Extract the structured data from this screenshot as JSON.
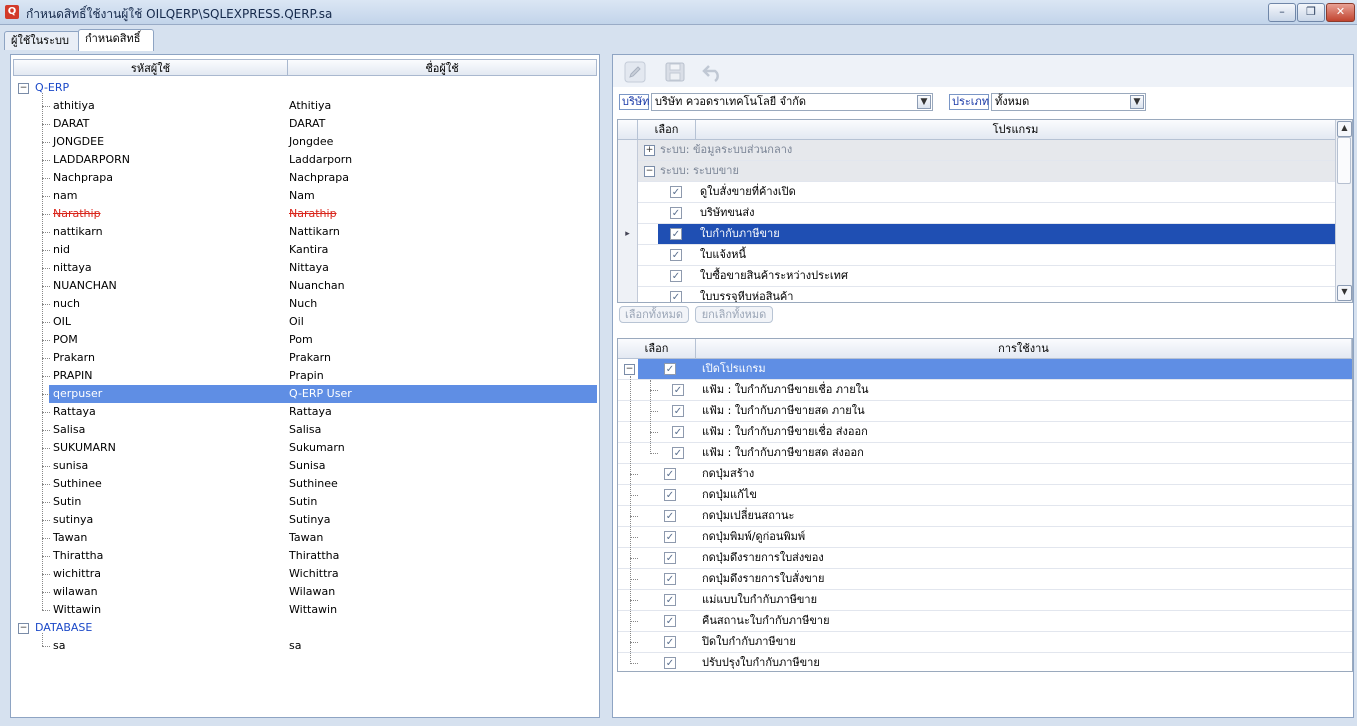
{
  "window": {
    "title": "กำหนดสิทธิ์ใช้งานผู้ใช้   OILQERP\\SQLEXPRESS.QERP.sa",
    "minimize": "–",
    "restore": "❐",
    "close": "✕"
  },
  "tabs": [
    "ผู้ใช้ในระบบ",
    "กำหนดสิทธิ์"
  ],
  "users_panel": {
    "col_code": "รหัสผู้ใช้",
    "col_name": "ชื่อผู้ใช้",
    "group1": "Q-ERP",
    "group2": "DATABASE",
    "users": [
      {
        "code": "athitiya",
        "name": "Athitiya"
      },
      {
        "code": "DARAT",
        "name": "DARAT"
      },
      {
        "code": "JONGDEE",
        "name": "Jongdee"
      },
      {
        "code": "LADDARPORN",
        "name": "Laddarporn"
      },
      {
        "code": "Nachprapa",
        "name": "Nachprapa"
      },
      {
        "code": "nam",
        "name": "Nam"
      },
      {
        "code": "Narathip",
        "name": "Narathip"
      },
      {
        "code": "nattikarn",
        "name": "Nattikarn"
      },
      {
        "code": "nid",
        "name": "Kantira"
      },
      {
        "code": "nittaya",
        "name": "Nittaya"
      },
      {
        "code": "NUANCHAN",
        "name": "Nuanchan"
      },
      {
        "code": "nuch",
        "name": "Nuch"
      },
      {
        "code": "OIL",
        "name": "Oil"
      },
      {
        "code": "POM",
        "name": "Pom"
      },
      {
        "code": "Prakarn",
        "name": "Prakarn"
      },
      {
        "code": "PRAPIN",
        "name": "Prapin"
      },
      {
        "code": "qerpuser",
        "name": "Q-ERP User"
      },
      {
        "code": "Rattaya",
        "name": "Rattaya"
      },
      {
        "code": "Salisa",
        "name": "Salisa"
      },
      {
        "code": "SUKUMARN",
        "name": "Sukumarn"
      },
      {
        "code": "sunisa",
        "name": "Sunisa"
      },
      {
        "code": "Suthinee",
        "name": "Suthinee"
      },
      {
        "code": "Sutin",
        "name": "Sutin"
      },
      {
        "code": "sutinya",
        "name": "Sutinya"
      },
      {
        "code": "Tawan",
        "name": "Tawan"
      },
      {
        "code": "Thirattha",
        "name": "Thirattha"
      },
      {
        "code": "wichittra",
        "name": "Wichittra"
      },
      {
        "code": "wilawan",
        "name": "Wilawan"
      },
      {
        "code": "Wittawin",
        "name": "Wittawin"
      }
    ],
    "db_users": [
      {
        "code": "sa",
        "name": "sa"
      }
    ],
    "selected_user": "qerpuser",
    "disabled_user": "Narathip"
  },
  "filters": {
    "company_label": "บริษัท",
    "company_value": "บริษัท  ควอดราเทคโนโลยี  จำกัด",
    "type_label": "ประเภท",
    "type_value": "ทั้งหมด"
  },
  "programs_grid": {
    "col_select": "เลือก",
    "col_program": "โปรแกรม",
    "groups": [
      "ระบบ: ข้อมูลระบบส่วนกลาง",
      "ระบบ: ระบบขาย"
    ],
    "rows": [
      "ดูใบสั่งขายที่ค้างเปิด",
      "บริษัทขนส่ง",
      "ใบกำกับภาษีขาย",
      "ใบแจ้งหนี้",
      "ใบซื้อขายสินค้าระหว่างประเทศ",
      "ใบบรรจุหีบห่อสินค้า"
    ],
    "selected_row": "ใบกำกับภาษีขาย",
    "select_all": "เลือกทั้งหมด",
    "deselect_all": "ยกเลิกทั้งหมด"
  },
  "usage_grid": {
    "col_select": "เลือก",
    "col_usage": "การใช้งาน",
    "root": "เปิดโปรแกรม",
    "children": [
      "แฟ้ม : ใบกำกับภาษีขายเชื่อ ภายใน",
      "แฟ้ม : ใบกำกับภาษีขายสด ภายใน",
      "แฟ้ม : ใบกำกับภาษีขายเชื่อ ส่งออก",
      "แฟ้ม : ใบกำกับภาษีขายสด ส่งออก"
    ],
    "items": [
      "กดปุ่มสร้าง",
      "กดปุ่มแก้ไข",
      "กดปุ่มเปลี่ยนสถานะ",
      "กดปุ่มพิมพ์/ดูก่อนพิมพ์",
      "กดปุ่มดึงรายการใบส่งของ",
      "กดปุ่มดึงรายการใบสั่งขาย",
      "แม่แบบใบกำกับภาษีขาย",
      "คืนสถานะใบกำกับภาษีขาย",
      "ปิดใบกำกับภาษีขาย",
      "ปรับปรุงใบกำกับภาษีขาย"
    ]
  },
  "toolbar": {
    "edit_icon": "pencil-icon",
    "save_icon": "floppy-icon",
    "undo_icon": "undo-icon"
  },
  "colors": {
    "selection": "#5f8ee4",
    "group_blue": "#1b49c8",
    "disabled_red": "#d9261c"
  }
}
